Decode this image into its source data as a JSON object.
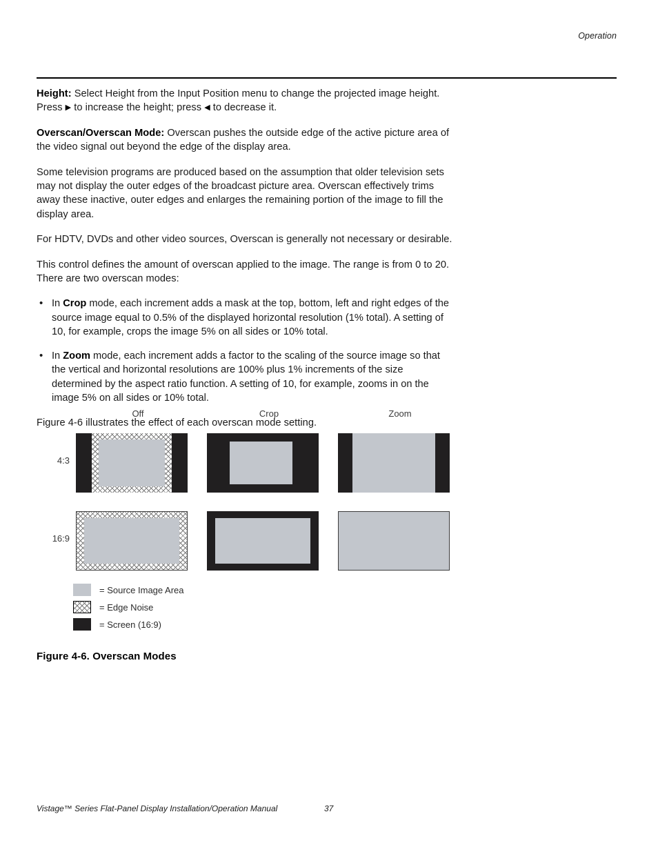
{
  "header": {
    "section_title": "Operation"
  },
  "body": {
    "height_label": "Height:",
    "height_text_a": " Select Height from the Input Position menu to change the projected image height. Press ",
    "right_arrow": "▶",
    "height_text_b": " to increase the height; press ",
    "left_arrow": "◀",
    "height_text_c": " to decrease it.",
    "overscan_label": "Overscan/Overscan Mode:",
    "overscan_text": " Overscan pushes the outside edge of the active picture area of the video signal out beyond the edge of the display area.",
    "para_television": "Some television programs are produced based on the assumption that older television sets may not display the outer edges of the broadcast picture area. Overscan effectively trims away these inactive, outer edges and enlarges the remaining portion of the image to fill the display area.",
    "para_hdtv": "For HDTV, DVDs and other video sources, Overscan is generally not necessary or desirable.",
    "para_range": "This control defines the amount of overscan applied to the image. The range is from 0 to 20. There are two overscan modes:",
    "bullets": [
      {
        "marker": "•",
        "prefix": "In ",
        "term": "Crop",
        "text": " mode, each increment adds a mask at the top, bottom, left and right edges of the source image equal to 0.5% of the displayed horizontal resolution (1% total). A setting of 10, for example, crops the image 5% on all sides or 10% total."
      },
      {
        "marker": "•",
        "prefix": "In ",
        "term": "Zoom",
        "text": " mode, each increment adds a factor to the scaling of the source image so that the vertical and horizontal resolutions are 100% plus 1% increments of the size determined by the aspect ratio function. A setting of 10, for example, zooms in on the image 5% on all sides or 10% total."
      }
    ],
    "para_figure_ref": "Figure 4-6 illustrates the effect of each overscan mode setting."
  },
  "figure": {
    "column_headers": [
      "Off",
      "Crop",
      "Zoom"
    ],
    "row_labels": [
      "4:3",
      "16:9"
    ],
    "caption": "Figure 4-6. Overscan Modes",
    "legend": [
      {
        "swatch": "source-image-swatch",
        "text": "= Source Image Area"
      },
      {
        "swatch": "edge-noise-swatch",
        "text": "= Edge Noise"
      },
      {
        "swatch": "screen-swatch",
        "text": "= Screen (16:9)"
      }
    ],
    "colors": {
      "screen_black": "#211f20",
      "source_image_gray": "#c2c6cc",
      "edge_noise_line": "#7c7c7c"
    }
  },
  "footer": {
    "manual_title": "Vistage™ Series Flat-Panel Display Installation/Operation Manual",
    "page_number": "37"
  }
}
